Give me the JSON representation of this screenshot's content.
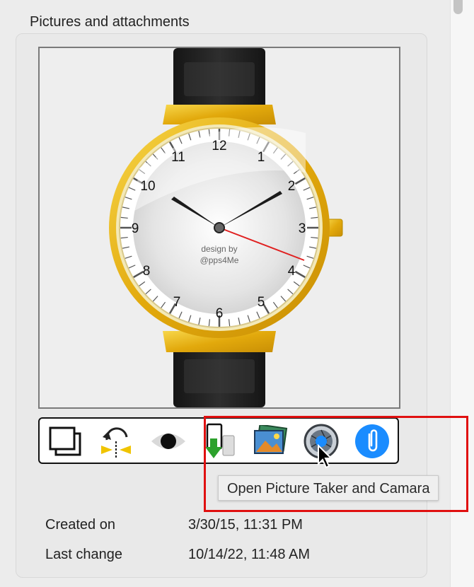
{
  "section": {
    "title": "Pictures and attachments"
  },
  "image": {
    "alt": "Wristwatch picture",
    "dial_numbers": [
      "12",
      "1",
      "2",
      "3",
      "4",
      "5",
      "6",
      "7",
      "8",
      "9",
      "10",
      "11"
    ],
    "dial_text_line1": "design by",
    "dial_text_line2": "@pps4Me"
  },
  "toolbar": {
    "items": [
      {
        "name": "picture-frames-icon"
      },
      {
        "name": "rotate-flip-icon"
      },
      {
        "name": "eye-icon"
      },
      {
        "name": "import-icon"
      },
      {
        "name": "photos-icon"
      },
      {
        "name": "camera-shutter-icon"
      },
      {
        "name": "paperclip-icon"
      }
    ]
  },
  "tooltip": {
    "text": "Open Picture Taker and Camara"
  },
  "meta": {
    "created_label": "Created on",
    "created_value": "3/30/15, 11:31 PM",
    "changed_label": "Last change",
    "changed_value": "10/14/22, 11:48 AM"
  },
  "colors": {
    "highlight": "#e01010",
    "accent_blue": "#1a8cff",
    "gold": "#e7b411"
  }
}
